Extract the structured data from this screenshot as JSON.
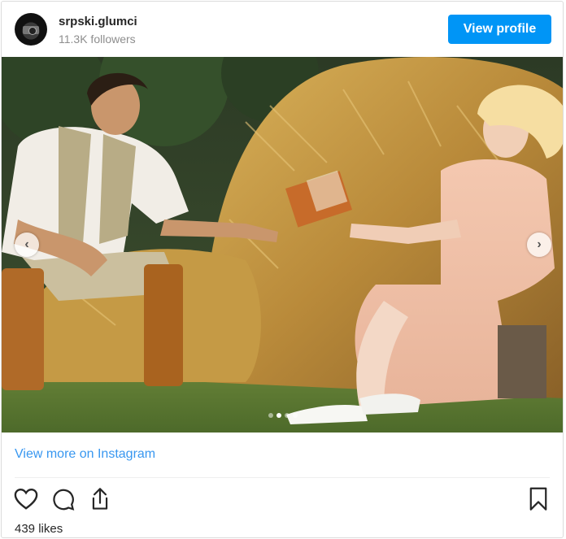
{
  "header": {
    "username": "srpski.glumci",
    "followers": "11.3K followers",
    "view_profile_label": "View profile"
  },
  "carousel": {
    "prev_icon": "chevron-left-icon",
    "next_icon": "chevron-right-icon",
    "prev_glyph": "‹",
    "next_glyph": "›",
    "slide_count": 4,
    "active_slide": 2
  },
  "footer": {
    "view_more_label": "View more on Instagram",
    "likes": "439 likes"
  },
  "actions": [
    "heart-icon",
    "comment-icon",
    "share-icon",
    "bookmark-icon"
  ],
  "colors": {
    "accent": "#0095f6",
    "link": "#3897f0"
  }
}
